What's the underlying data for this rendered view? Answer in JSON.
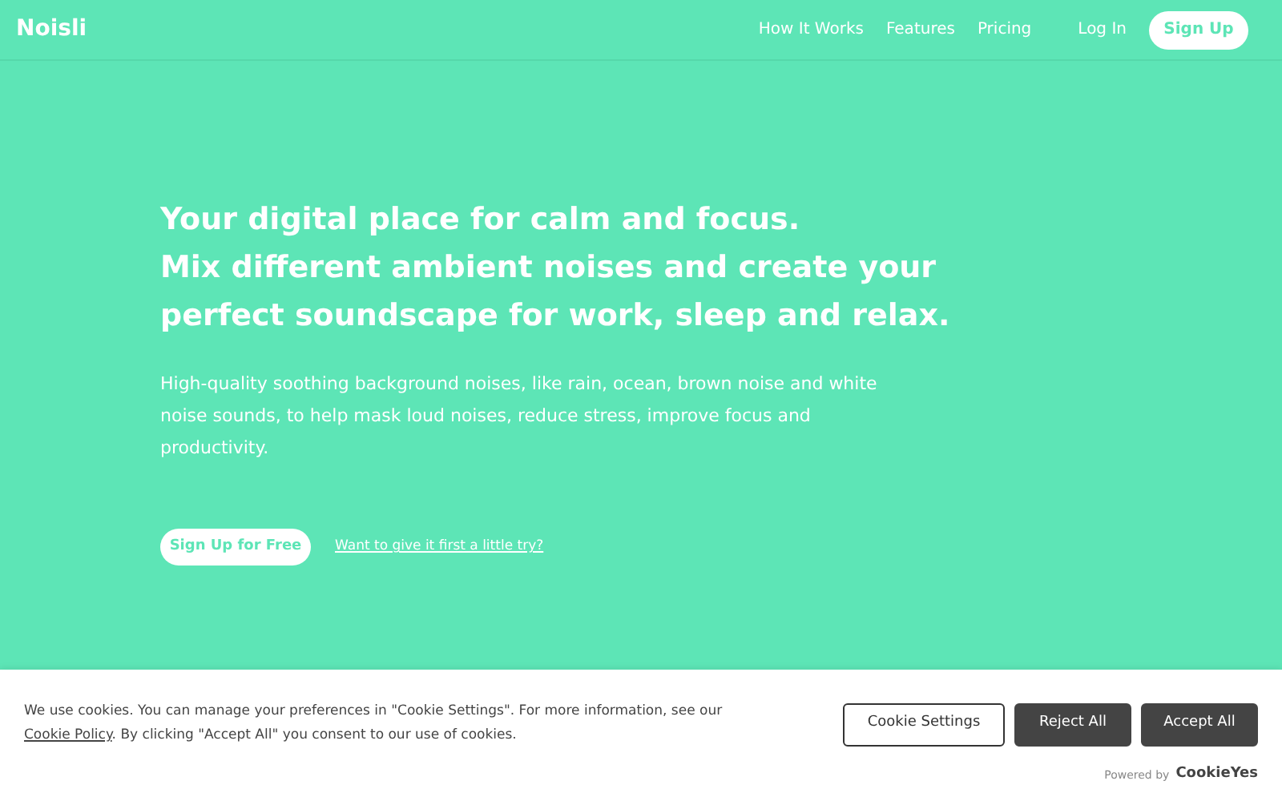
{
  "header": {
    "logo": "Noisli",
    "nav": [
      "How It Works",
      "Features",
      "Pricing"
    ],
    "login": "Log In",
    "signup": "Sign Up"
  },
  "hero": {
    "headline": [
      "Your digital place for calm and focus.",
      "Mix different ambient noises and create your",
      "perfect soundscape for work, sleep and relax."
    ],
    "description": "High-quality soothing background noises, like rain, ocean, brown noise and white noise sounds, to help mask loud noises, reduce stress, improve focus and productivity.",
    "cta": "Sign Up for Free",
    "try_link": "Want to give it first a little try?"
  },
  "cookie_banner": {
    "text_before": "We use cookies. You can manage your preferences in \"Cookie Settings\". For more information, see our",
    "link": "Cookie Policy",
    "text_after": ". By clicking \"Accept All\" you consent to our use of cookies.",
    "buttons": [
      {
        "label": "Cookie Settings",
        "kind": "outline"
      },
      {
        "label": "Reject All",
        "kind": "filled"
      },
      {
        "label": "Accept All",
        "kind": "filled"
      }
    ],
    "powered_by": "Powered by",
    "brand": "CookieYes"
  }
}
